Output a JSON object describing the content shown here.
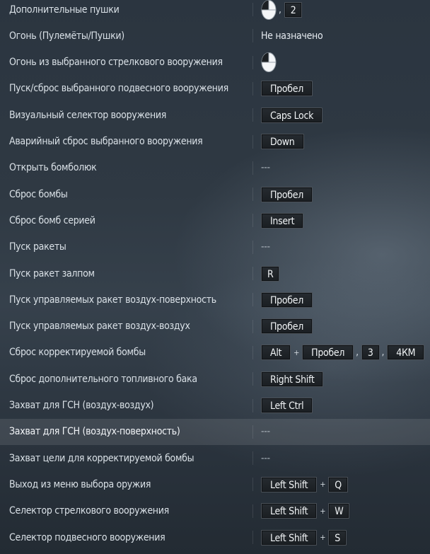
{
  "rows": [
    {
      "label": "Дополнительные пушки",
      "binding": [
        {
          "t": "mouse-icon"
        },
        {
          "t": "comma",
          "v": ","
        },
        {
          "t": "key",
          "v": "2"
        }
      ]
    },
    {
      "label": "Огонь (Пулемёты/Пушки)",
      "binding": [
        {
          "t": "plain",
          "v": "Не назначено"
        }
      ]
    },
    {
      "label": "Огонь из выбранного стрелкового вооружения",
      "binding": [
        {
          "t": "mouse-icon"
        }
      ]
    },
    {
      "label": "Пуск/сброс выбранного подвесного вооружения",
      "binding": [
        {
          "t": "key",
          "v": "Пробел"
        }
      ]
    },
    {
      "label": "Визуальный селектор вооружения",
      "binding": [
        {
          "t": "key",
          "v": "Caps Lock"
        }
      ]
    },
    {
      "label": "Аварийный сброс выбранного вооружения",
      "binding": [
        {
          "t": "key",
          "v": "Down"
        }
      ]
    },
    {
      "label": "Открыть бомболюк",
      "binding": [
        {
          "t": "dash",
          "v": "---"
        }
      ]
    },
    {
      "label": "Сброс бомбы",
      "binding": [
        {
          "t": "key",
          "v": "Пробел"
        }
      ]
    },
    {
      "label": "Сброс бомб серией",
      "binding": [
        {
          "t": "key",
          "v": "Insert"
        }
      ]
    },
    {
      "label": "Пуск ракеты",
      "binding": [
        {
          "t": "dash",
          "v": "---"
        }
      ]
    },
    {
      "label": "Пуск ракет залпом",
      "binding": [
        {
          "t": "key",
          "v": "R"
        }
      ]
    },
    {
      "label": "Пуск управляемых ракет воздух-поверхность",
      "binding": [
        {
          "t": "key",
          "v": "Пробел"
        }
      ]
    },
    {
      "label": "Пуск управляемых ракет воздух-воздух",
      "binding": [
        {
          "t": "key",
          "v": "Пробел"
        }
      ]
    },
    {
      "label": "Сброс корректируемой бомбы",
      "binding": [
        {
          "t": "key",
          "v": "Alt"
        },
        {
          "t": "joiner",
          "v": "+"
        },
        {
          "t": "key",
          "v": "Пробел"
        },
        {
          "t": "comma",
          "v": ","
        },
        {
          "t": "key",
          "v": "3"
        },
        {
          "t": "comma",
          "v": ","
        },
        {
          "t": "key",
          "v": "4КМ"
        }
      ]
    },
    {
      "label": "Сброс дополнительного топливного бака",
      "binding": [
        {
          "t": "key",
          "v": "Right Shift"
        }
      ]
    },
    {
      "label": "Захват для ГСН (воздух-воздух)",
      "binding": [
        {
          "t": "key",
          "v": "Left Ctrl"
        }
      ]
    },
    {
      "label": "Захват для ГСН (воздух-поверхность)",
      "binding": [
        {
          "t": "dash",
          "v": "---"
        }
      ],
      "highlighted": true
    },
    {
      "label": "Захват цели для корректируемой бомбы",
      "binding": [
        {
          "t": "dash",
          "v": "---"
        }
      ]
    },
    {
      "label": "Выход из меню выбора оружия",
      "binding": [
        {
          "t": "key",
          "v": "Left Shift"
        },
        {
          "t": "joiner",
          "v": "+"
        },
        {
          "t": "key",
          "v": "Q"
        }
      ]
    },
    {
      "label": "Селектор стрелкового вооружения",
      "binding": [
        {
          "t": "key",
          "v": "Left Shift"
        },
        {
          "t": "joiner",
          "v": "+"
        },
        {
          "t": "key",
          "v": "W"
        }
      ]
    },
    {
      "label": "Селектор подвесного вооружения",
      "binding": [
        {
          "t": "key",
          "v": "Left Shift"
        },
        {
          "t": "joiner",
          "v": "+"
        },
        {
          "t": "key",
          "v": "S"
        }
      ]
    }
  ]
}
